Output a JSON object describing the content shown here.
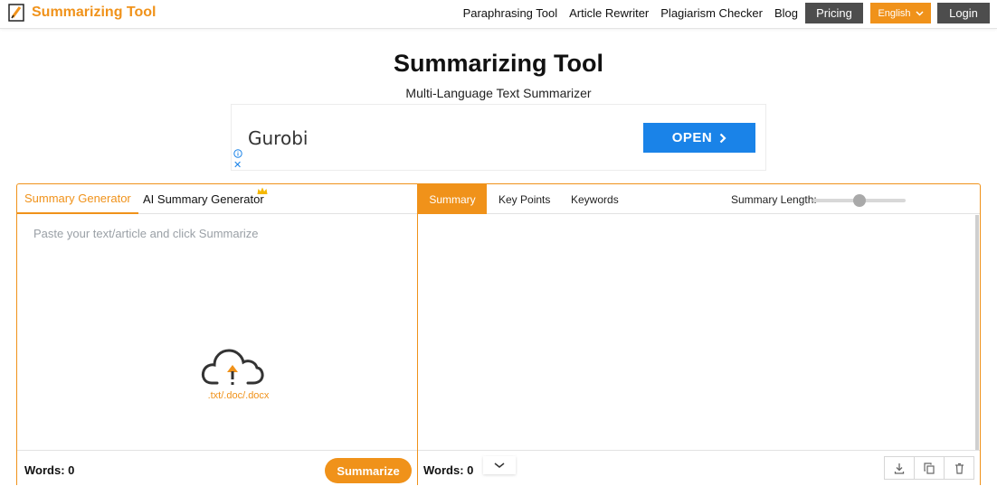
{
  "brand": {
    "name": "Summarizing Tool"
  },
  "nav": {
    "links": [
      "Paraphrasing Tool",
      "Article Rewriter",
      "Plagiarism Checker",
      "Blog"
    ],
    "pricing": "Pricing",
    "language": "English",
    "login": "Login"
  },
  "header": {
    "title": "Summarizing Tool",
    "subtitle": "Multi-Language Text Summarizer"
  },
  "ad": {
    "advertiser": "Gurobi",
    "cta": "OPEN"
  },
  "left_panel": {
    "tabs": [
      "Summary Generator",
      "AI Summary Generator"
    ],
    "active_tab": "Summary Generator",
    "placeholder": "Paste your text/article and click Summarize",
    "upload_formats": ".txt/.doc/.docx",
    "words_label": "Words: 0",
    "summarize_button": "Summarize"
  },
  "right_panel": {
    "tabs": [
      "Summary",
      "Key Points",
      "Keywords"
    ],
    "active_tab": "Summary",
    "length_label": "Summary Length:",
    "length_value": 0.5,
    "words_label": "Words: 0",
    "actions": [
      "download-icon",
      "copy-icon",
      "trash-icon"
    ]
  },
  "colors": {
    "accent": "#f0921a",
    "dark_button": "#4d4d4d",
    "ad_button": "#1a83e8"
  }
}
